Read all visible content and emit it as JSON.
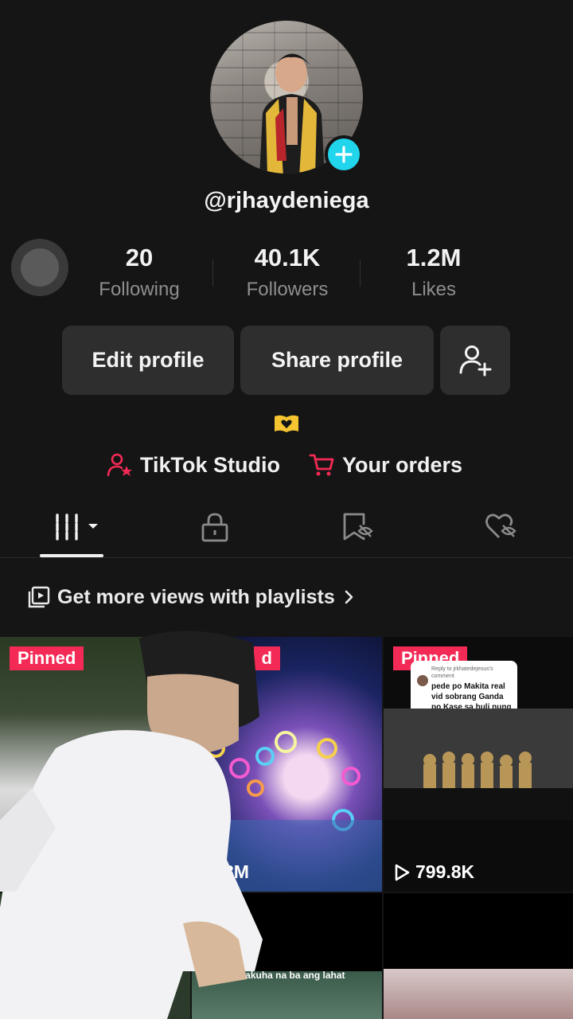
{
  "profile": {
    "username": "@rjhaydeniega",
    "stats": [
      {
        "value": "20",
        "label": "Following"
      },
      {
        "value": "40.1K",
        "label": "Followers"
      },
      {
        "value": "1.2M",
        "label": "Likes"
      }
    ]
  },
  "actions": {
    "edit_profile": "Edit profile",
    "share_profile": "Share profile"
  },
  "links": {
    "studio": "TikTok Studio",
    "orders": "Your orders"
  },
  "playlist_prompt": "Get more views with playlists",
  "videos": [
    {
      "pinned": "Pinned",
      "views": ""
    },
    {
      "pinned": "d",
      "views": "8M"
    },
    {
      "pinned": "Pinned",
      "views": "799.8K"
    },
    {
      "caption": "nakakuha na ba ang lahat"
    }
  ],
  "comment_card": {
    "header": "Reply to jrkhatedejesus's comment",
    "text": "pede po Makita real vid sobrang Ganda po Kase sa huli nung binaril SI jose Rizal"
  },
  "colors": {
    "accent_pink": "#f22a55",
    "accent_cyan": "#20d5ec",
    "background": "#151515",
    "button_bg": "#2e2e2e"
  },
  "icons": {
    "plus": "plus-icon",
    "add_friend": "add-friend-icon",
    "studio": "person-star-icon",
    "orders": "cart-icon",
    "videos_tab": "grid-icon",
    "private_tab": "lock-icon",
    "favorites_tab": "bookmark-eye-off-icon",
    "liked_tab": "heart-eye-off-icon",
    "playlist": "playlist-icon",
    "bio": "book-heart-icon"
  }
}
